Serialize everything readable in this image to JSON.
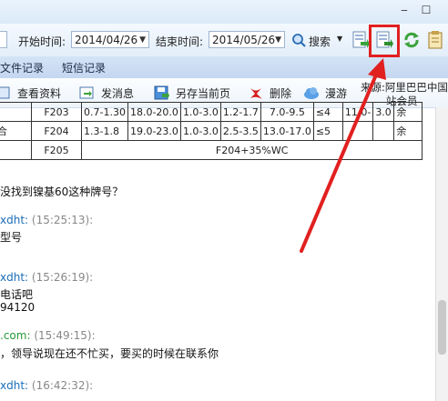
{
  "filter": {
    "start_label": "开始时间:",
    "start_date": "2014/04/26",
    "end_label": "结束时间:",
    "end_date": "2014/05/26",
    "search_label": "搜索"
  },
  "tabs": [
    "文件记录",
    "短信记录"
  ],
  "actions": {
    "view_profile": "查看资料",
    "send_message": "发消息",
    "save_page": "另存当前页",
    "delete": "删除",
    "roam": "漫游"
  },
  "source": {
    "line1": "来源:阿里巴巴中国",
    "line2": "站会员"
  },
  "table": {
    "rows": [
      [
        "",
        "F203",
        "0.7-1.30",
        "18.0-20.0",
        "1.0-3.0",
        "1.2-1.7",
        "7.0-9.5",
        "≤4",
        "11.0-",
        "3.0",
        "余"
      ],
      [
        "合",
        "F204",
        "1.3-1.8",
        "19.0-23.0",
        "1.0-3.0",
        "2.5-3.5",
        "13.0-17.0",
        "≤5",
        "",
        "",
        "余"
      ]
    ],
    "last_row": {
      "c0": "",
      "code": "F205",
      "note": "F204+35%WC"
    }
  },
  "chat": {
    "line_question": "没找到镍基60这种牌号？",
    "msg1": {
      "sender": "xdht:",
      "time": "(15:25:13):",
      "text": "型号"
    },
    "msg2": {
      "sender": "xdht:",
      "time": "(15:26:19):",
      "text1": "电话吧",
      "text2": "94120"
    },
    "msg3": {
      "sender": ".com:",
      "time": "(15:49:15):",
      "text": "，领导说现在还不忙买，要买的时候在联系你"
    },
    "msg4": {
      "sender": "xdht:",
      "time": "(16:42:32):"
    }
  },
  "colors": {
    "highlight": "#e12020",
    "sender": "#1a6db8"
  }
}
